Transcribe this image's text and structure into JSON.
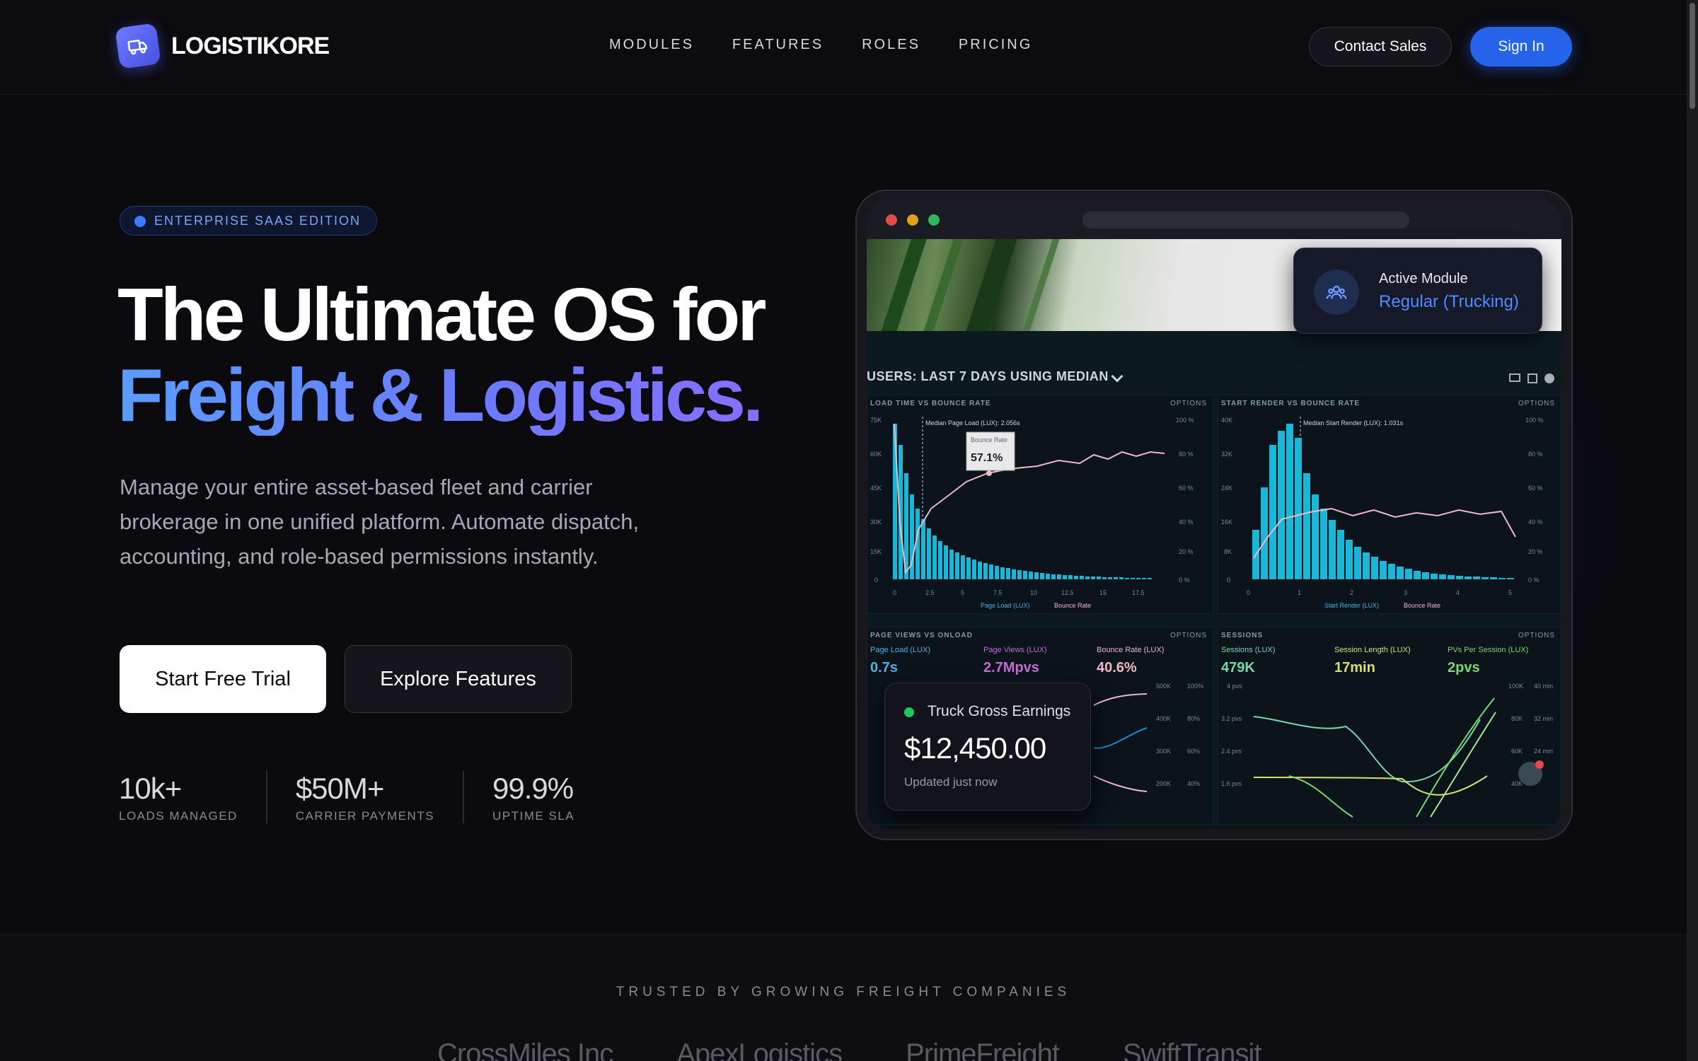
{
  "brand": {
    "name": "LOGISTIKORE",
    "accent": "#2563eb"
  },
  "nav": {
    "links": [
      "MODULES",
      "FEATURES",
      "ROLES",
      "PRICING"
    ],
    "contact_label": "Contact Sales",
    "signin_label": "Sign In"
  },
  "hero": {
    "badge": "ENTERPRISE SAAS EDITION",
    "headline_line1": "The Ultimate OS for",
    "headline_line2": "Freight & Logistics.",
    "subtitle": "Manage your entire asset-based fleet and carrier brokerage in one unified platform. Automate dispatch, accounting, and role-based permissions instantly.",
    "cta_primary": "Start Free Trial",
    "cta_secondary": "Explore Features",
    "stats": [
      {
        "value": "10k+",
        "label": "LOADS MANAGED"
      },
      {
        "value": "$50M+",
        "label": "CARRIER PAYMENTS"
      },
      {
        "value": "99.9%",
        "label": "UPTIME SLA"
      }
    ]
  },
  "mockup": {
    "module_card": {
      "label": "Active Module",
      "value": "Regular (Trucking)"
    },
    "dashboard": {
      "title": "USERS: LAST 7 DAYS USING MEDIAN",
      "panel1_title": "LOAD TIME VS BOUNCE RATE",
      "panel2_title": "START RENDER VS BOUNCE RATE",
      "panel3_title": "PAGE VIEWS VS ONLOAD",
      "panel4_title": "SESSIONS",
      "options_label": "OPTIONS",
      "tooltip_label": "Bounce Rate",
      "tooltip_value": "57.1%",
      "median1": "Median Page Load (LUX): 2.056s",
      "median2": "Median Start Render (LUX): 1.031s",
      "legend1a": "Page Load (LUX)",
      "legend1b": "Bounce Rate",
      "legend2a": "Start Render (LUX)",
      "legend2b": "Bounce Rate",
      "metrics": [
        {
          "label": "Page Load (LUX)",
          "value": "0.7s",
          "color": "#4db0e8"
        },
        {
          "label": "Page Views (LUX)",
          "value": "2.7Mpvs",
          "color": "#c86ad8"
        },
        {
          "label": "Bounce Rate (LUX)",
          "value": "40.6%",
          "color": "#f0b8c8"
        },
        {
          "label": "Sessions (LUX)",
          "value": "479K",
          "color": "#7ad8a8"
        },
        {
          "label": "Session Length (LUX)",
          "value": "17min",
          "color": "#d8e070"
        },
        {
          "label": "PVs Per Session (LUX)",
          "value": "2pvs",
          "color": "#7ad870"
        }
      ]
    },
    "earnings_card": {
      "label": "Truck Gross Earnings",
      "value": "$12,450.00",
      "updated": "Updated just now"
    }
  },
  "trusted": {
    "title": "TRUSTED BY GROWING FREIGHT COMPANIES",
    "companies": [
      "CrossMiles Inc",
      "ApexLogistics",
      "PrimeFreight",
      "SwiftTransit"
    ]
  }
}
